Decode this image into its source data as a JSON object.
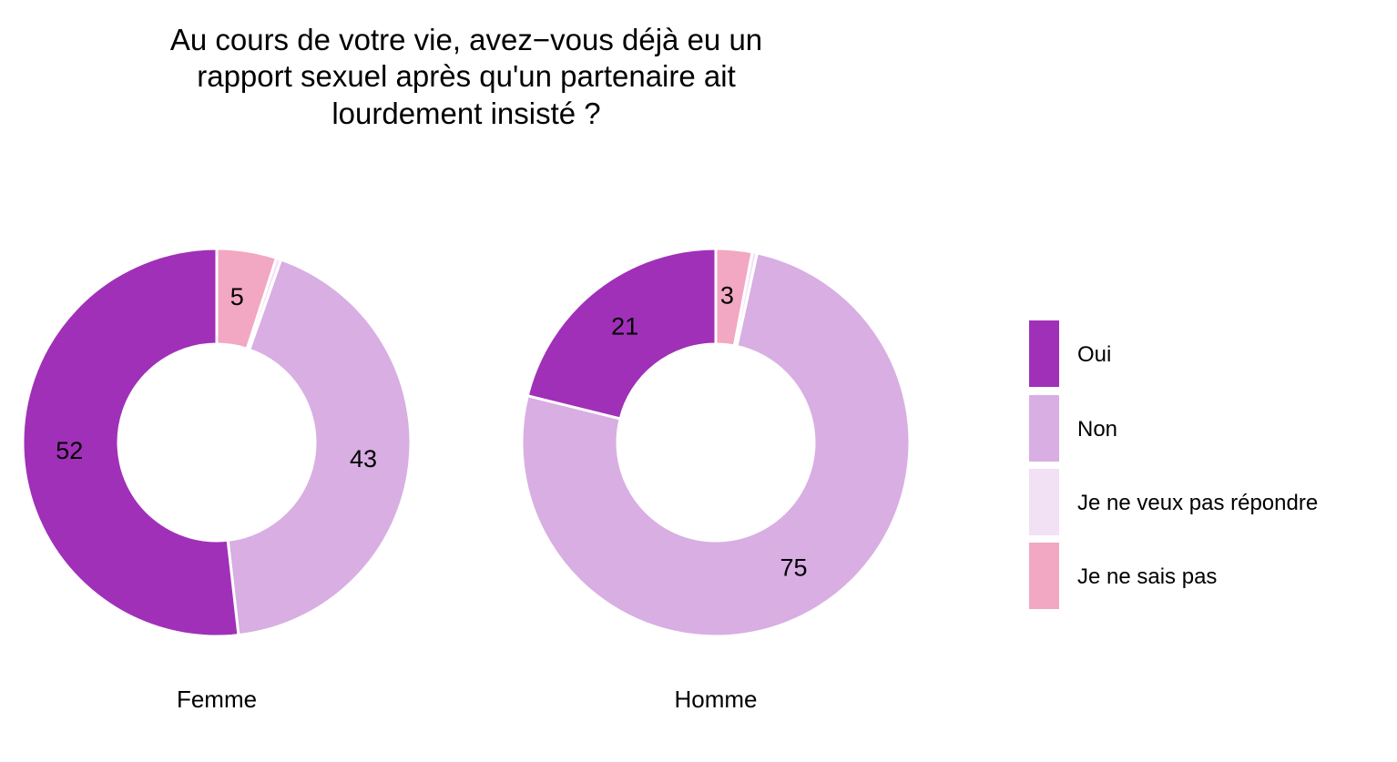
{
  "chart_data": {
    "type": "pie",
    "title_lines": [
      "Au cours de votre vie, avez−vous déjà eu un",
      "rapport sexuel après qu'un partenaire ait",
      "lourdement insisté ?"
    ],
    "categories": [
      "Oui",
      "Non",
      "Je ne veux pas répondre",
      "Je ne sais pas"
    ],
    "colors": {
      "Oui": "#a030b8",
      "Non": "#d8aee3",
      "Je ne veux pas répondre": "#f2e0f5",
      "Je ne sais pas": "#f2a7c3"
    },
    "facets": [
      {
        "label": "Femme",
        "values": {
          "Je ne sais pas": 5,
          "Je ne veux pas répondre": 0.4,
          "Non": 43,
          "Oui": 52
        },
        "labels": {
          "Je ne sais pas": "5",
          "Je ne veux pas répondre": "0",
          "Non": "43",
          "Oui": "52"
        }
      },
      {
        "label": "Homme",
        "values": {
          "Je ne sais pas": 3,
          "Je ne veux pas répondre": 0.4,
          "Non": 75,
          "Oui": 21
        },
        "labels": {
          "Je ne sais pas": "3",
          "Je ne veux pas répondre": "0",
          "Non": "75",
          "Oui": "21"
        }
      }
    ],
    "slice_order": [
      "Je ne sais pas",
      "Je ne veux pas répondre",
      "Non",
      "Oui"
    ],
    "legend_position": "right",
    "grid": false
  }
}
